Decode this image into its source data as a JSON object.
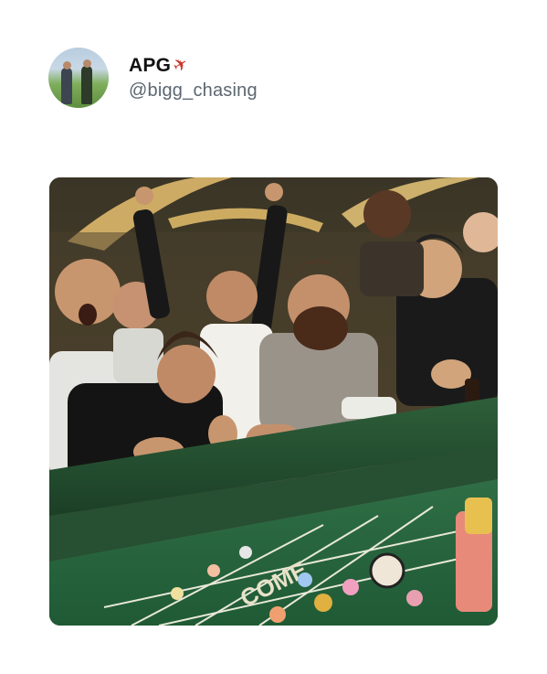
{
  "tweet": {
    "display_name": "APG",
    "handle": "@bigg_chasing",
    "name_emoji": "airplane-icon",
    "media": {
      "type": "photo",
      "table_text": "COME"
    }
  }
}
